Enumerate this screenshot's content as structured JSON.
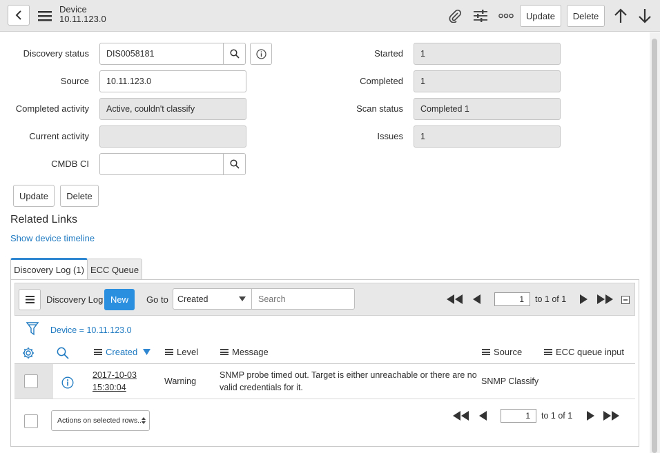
{
  "header": {
    "title": "Device",
    "subtitle": "10.11.123.0",
    "back_icon": "chevron-left-icon",
    "menu_icon": "hamburger-icon",
    "attach_icon": "paperclip-icon",
    "settings_icon": "sliders-icon",
    "more_icon": "more-icon",
    "update_label": "Update",
    "delete_label": "Delete",
    "up_icon": "arrow-up-icon",
    "down_icon": "arrow-down-icon"
  },
  "form": {
    "discovery_status": {
      "label": "Discovery status",
      "value": "DIS0058181"
    },
    "source": {
      "label": "Source",
      "value": "10.11.123.0"
    },
    "completed_activity": {
      "label": "Completed activity",
      "value": "Active, couldn't classify"
    },
    "current_activity": {
      "label": "Current activity",
      "value": ""
    },
    "cmdb_ci": {
      "label": "CMDB CI",
      "value": ""
    },
    "started": {
      "label": "Started",
      "value": "1"
    },
    "completed": {
      "label": "Completed",
      "value": "1"
    },
    "scan_status": {
      "label": "Scan status",
      "value": "Completed 1"
    },
    "issues": {
      "label": "Issues",
      "value": "1"
    },
    "update_label": "Update",
    "delete_label": "Delete"
  },
  "related_links": {
    "title": "Related Links",
    "show_timeline": "Show device timeline"
  },
  "tabs": [
    {
      "label": "Discovery Log (1)",
      "active": true
    },
    {
      "label": "ECC Queue",
      "active": false
    }
  ],
  "list": {
    "title": "Discovery Log",
    "new_label": "New",
    "goto_label": "Go to",
    "goto_field": "Created",
    "search_placeholder": "Search",
    "page_value": "1",
    "page_text": "to 1 of 1",
    "filter_text": "Device = 10.11.123.0",
    "columns": [
      "Created",
      "Level",
      "Message",
      "Source",
      "ECC queue input"
    ],
    "rows": [
      {
        "created_date": "2017-10-03",
        "created_time": "15:30:04",
        "level": "Warning",
        "message_line1": "SNMP probe timed out. Target is either unreachable or there are no",
        "message_line2": "valid credentials for it.",
        "source": "SNMP Classify",
        "ecc_queue_input": ""
      }
    ],
    "actions_label": "Actions on selected rows...",
    "bottom_page_value": "1",
    "bottom_page_text": "to 1 of 1"
  },
  "colors": {
    "accent": "#2f87d1",
    "link": "#1f7ac1",
    "new_button": "#2b8fe0"
  }
}
